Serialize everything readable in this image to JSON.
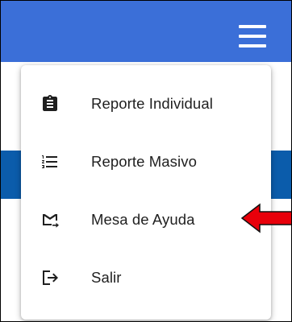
{
  "menu": {
    "items": [
      {
        "label": "Reporte Individual",
        "icon": "clipboard-icon"
      },
      {
        "label": "Reporte Masivo",
        "icon": "numbered-list-icon"
      },
      {
        "label": "Mesa de Ayuda",
        "icon": "mail-send-icon"
      },
      {
        "label": "Salir",
        "icon": "logout-icon"
      }
    ]
  },
  "header": {
    "menu_icon": "hamburger-menu-icon",
    "color": "#3b6fd8"
  },
  "band_color": "#0b5cab",
  "annotation": {
    "icon": "red-pointer-arrow",
    "color": "#e8000a"
  }
}
